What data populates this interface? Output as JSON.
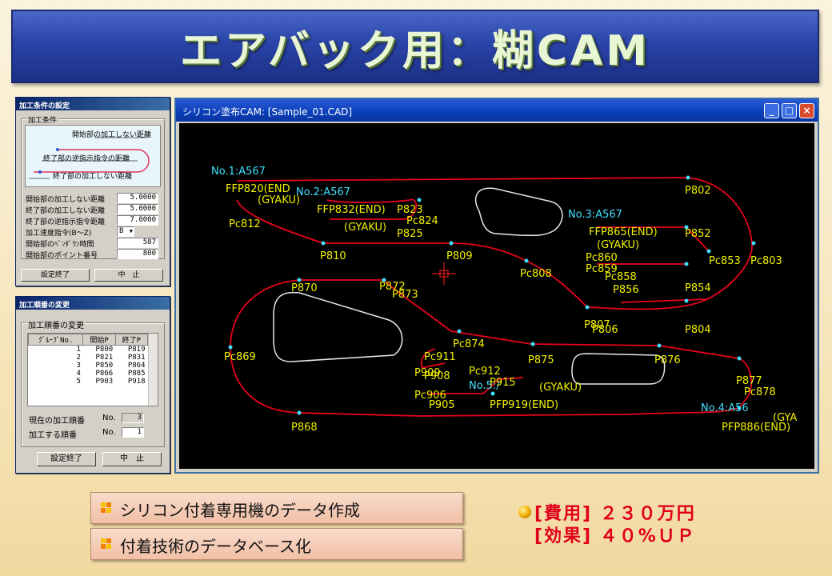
{
  "banner": {
    "title": "エアバック用：糊CAM"
  },
  "condition_dialog": {
    "title": "加工条件の設定",
    "group_label": "加工条件",
    "diagram": {
      "label_start": "開始部の加工しない距離",
      "label_reverse": "終了部の逆指示指令の距離",
      "label_end": "終了部の加工しない距離"
    },
    "rows": [
      {
        "label": "開始部の加工しない距離",
        "value": "5.0000"
      },
      {
        "label": "終了部の加工しない距離",
        "value": "5.0000"
      },
      {
        "label": "終了部の逆指示指令距離",
        "value": "7.0000"
      },
      {
        "label": "加工速度指令(B～Z)",
        "value": "B"
      },
      {
        "label": "開始部のﾍﾟﾝﾀﾞｳﾝ時間",
        "value": "587"
      },
      {
        "label": "開始部のポイント番号",
        "value": "800"
      }
    ],
    "ok_label": "設定終了",
    "cancel_label": "中　止"
  },
  "order_dialog": {
    "title": "加工順番の変更",
    "group_label": "加工順番の変更",
    "columns": [
      "ｸﾞﾙｰﾌﾟNo.",
      "開始P",
      "終了P"
    ],
    "rows": [
      [
        "1",
        "P800",
        "P819"
      ],
      [
        "2",
        "P821",
        "P831"
      ],
      [
        "3",
        "P850",
        "P864"
      ],
      [
        "4",
        "P866",
        "P885"
      ],
      [
        "5",
        "P903",
        "P918"
      ]
    ],
    "current_label": "現在の加工順番",
    "current_no_label": "No.",
    "current_value": "3",
    "new_label": "加工する順番",
    "new_no_label": "No.",
    "new_value": "1",
    "ok_label": "設定終了",
    "cancel_label": "中　止"
  },
  "cad_window": {
    "title": "シリコン塗布CAM: [Sample_01.CAD]",
    "min_label": "_",
    "max_label": "□",
    "close_label": "×",
    "labels_cyan": [
      "No.1:A567",
      "No.2:A567",
      "No.3:A567",
      "No.4:A56",
      "No.5:/"
    ],
    "labels_yellow": [
      "FFP820(END",
      "(GYAKU)",
      "Pc812",
      "FFP832(END)",
      "(GYAKU)",
      "P823",
      "Pc824",
      "P825",
      "P802",
      "FFP865(END)",
      "(GYAKU)",
      "P852",
      "Pc853",
      "Pc803",
      "Pc860",
      "Pc859",
      "Pc858",
      "P856",
      "P854",
      "P810",
      "P809",
      "Pc808",
      "P870",
      "P873",
      "P872",
      "P807",
      "P806",
      "P804",
      "Pc874",
      "Pc869",
      "P875",
      "P876",
      "Pc911",
      "P909",
      "P908",
      "Pc912",
      "P915",
      "(GYAKU)",
      "Pc906",
      "P905",
      "PFP919(END)",
      "P877",
      "Pc878",
      "(GYA",
      "P868",
      "PFP886(END)"
    ]
  },
  "features": [
    {
      "label": "シリコン付着専用機のデータ作成"
    },
    {
      "label": "付着技術のデータベース化"
    }
  ],
  "results": {
    "cost": "[費用] ２３０万円",
    "effect": "[効果] ４０%ＵＰ"
  },
  "colors": {
    "path": "#e8001c",
    "label": "#f0f000",
    "cyan": "#40e0ff",
    "obstacle": "#e8e8e8",
    "cursor": "#ff2020"
  }
}
